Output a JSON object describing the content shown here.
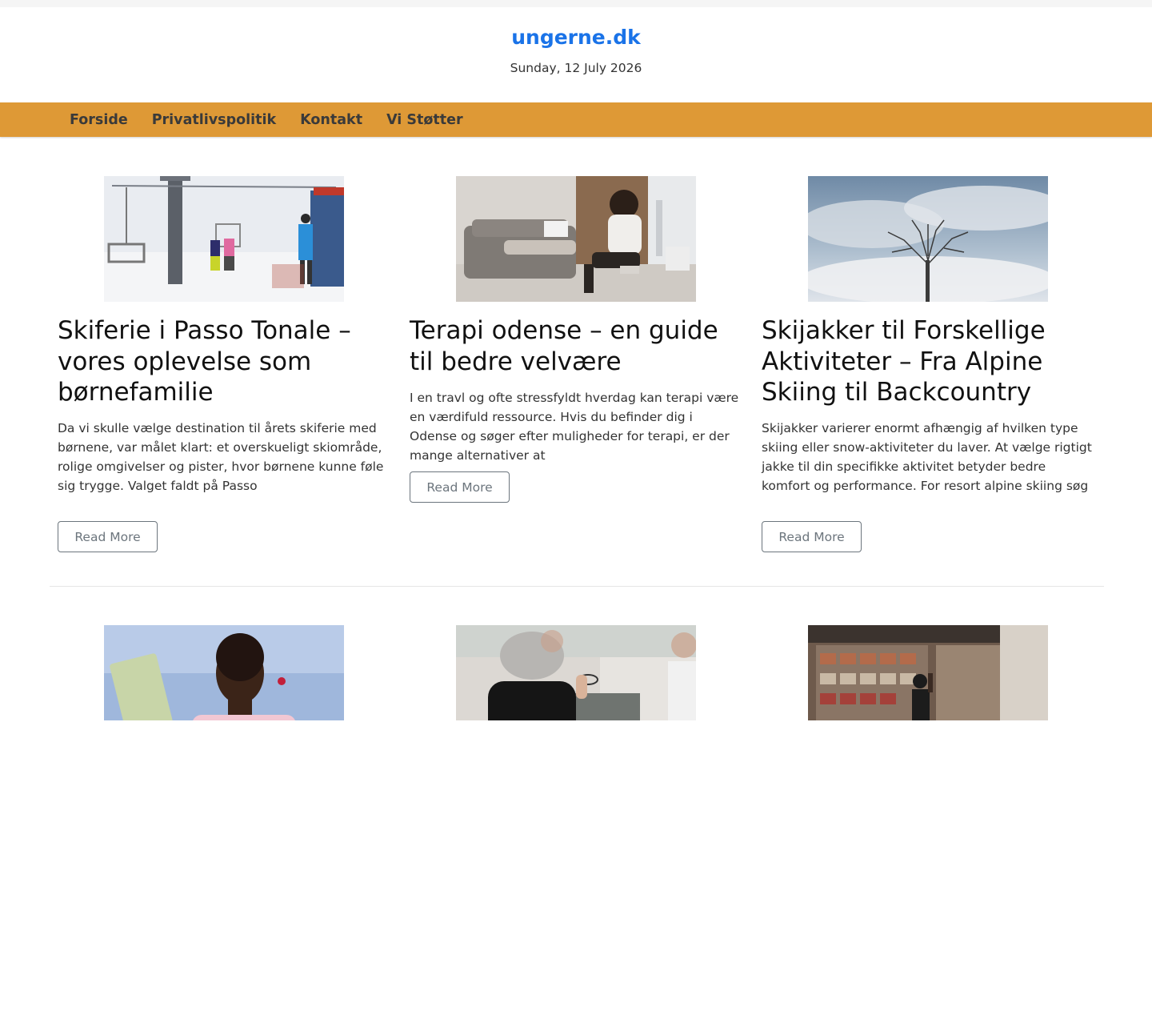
{
  "site": {
    "title": "ungerne.dk",
    "date": "Sunday, 12 July 2026"
  },
  "nav": {
    "items": [
      "Forside",
      "Privatlivspolitik",
      "Kontakt",
      "Vi Støtter"
    ]
  },
  "colors": {
    "brand": "#1a73e8",
    "nav_bg": "#de9936",
    "button_border": "#6c757d"
  },
  "articles": [
    {
      "title": "Skiferie i Passo Tonale – vores oplevelse som børnefamilie",
      "excerpt": "Da vi skulle vælge destination til årets skiferie med børnene, var målet klart: et overskueligt skiområde, rolige omgivelser og pister, hvor børnene kunne føle sig trygge. Valget faldt på Passo",
      "button": "Read More",
      "image": "ski-lift-photo"
    },
    {
      "title": "Terapi odense – en guide til bedre velvære",
      "excerpt": "I en travl og ofte stressfyldt hverdag kan terapi være en værdifuld ressource. Hvis du befinder dig i Odense og søger efter muligheder for terapi, er der mange alternativer at",
      "button": "Read More",
      "image": "woman-on-sofa-photo"
    },
    {
      "title": "Skijakker til Forskellige Aktiviteter – Fra Alpine Skiing til Backcountry",
      "excerpt": "Skijakker varierer enormt afhængig af hvilken type skiing eller snow-aktiviteter du laver. At vælge rigtigt jakke til din specifikke aktivitet betyder bedre komfort og performance. For resort alpine skiing søg",
      "button": "Read More",
      "image": "bare-tree-sky-photo"
    }
  ],
  "second_row_images": [
    "woman-reading-photo",
    "therapy-session-photo",
    "shop-shelves-photo"
  ]
}
